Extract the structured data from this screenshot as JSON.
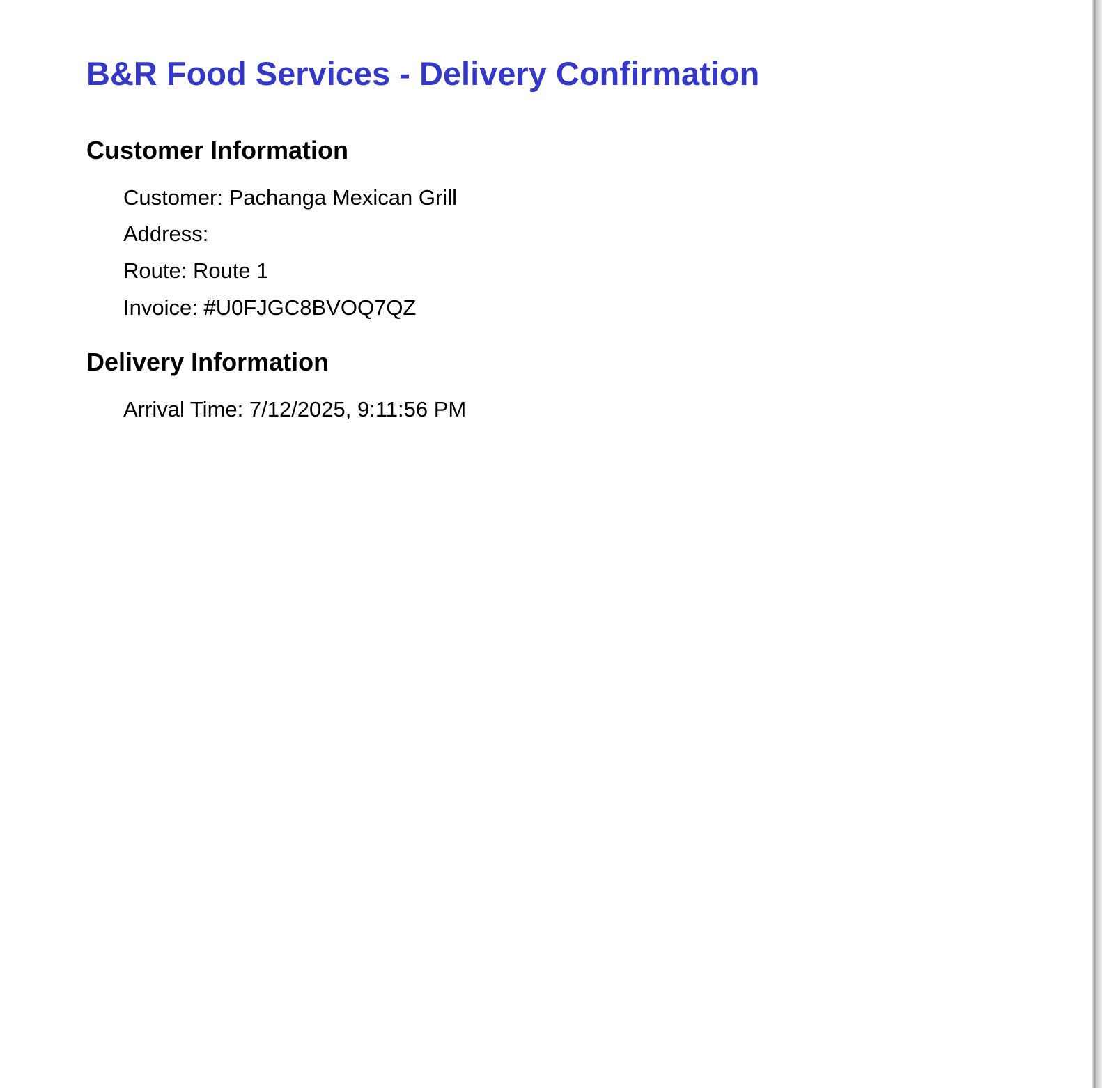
{
  "document": {
    "title": "B&R Food Services - Delivery Confirmation",
    "title_color": "#3338c8"
  },
  "customer_section": {
    "heading": "Customer Information",
    "customer": "Customer: Pachanga Mexican Grill",
    "address": "Address:",
    "route": "Route: Route 1",
    "invoice": "Invoice: #U0FJGC8BVOQ7QZ"
  },
  "delivery_section": {
    "heading": "Delivery Information",
    "arrival_time": "Arrival Time: 7/12/2025, 9:11:56 PM"
  }
}
